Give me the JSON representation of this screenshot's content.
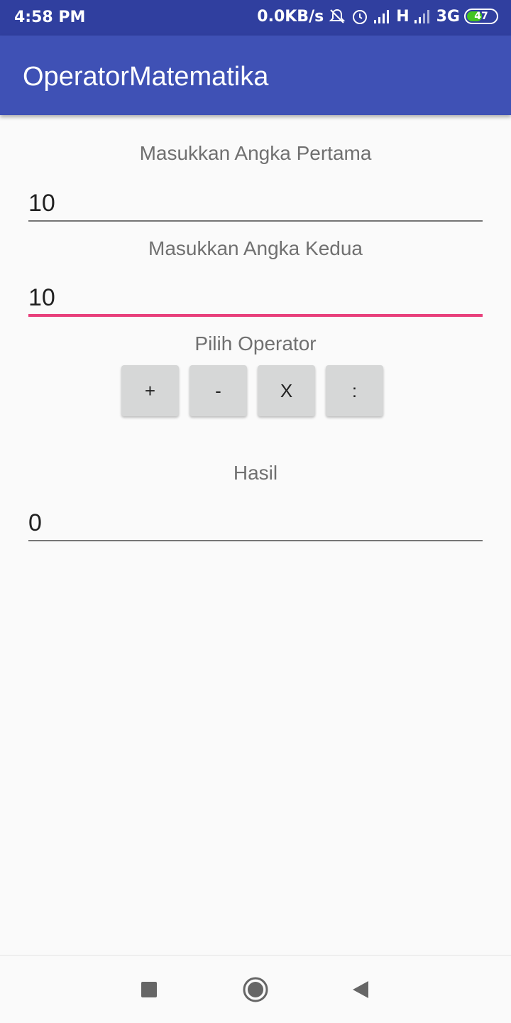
{
  "status_bar": {
    "time": "4:58 PM",
    "net_speed": "0.0KB/s",
    "net1": "H",
    "net2": "3G",
    "battery": "47",
    "battery_level": 0.47,
    "icons": [
      "mute-bell-icon",
      "alarm-icon",
      "signal-icon",
      "signal-icon",
      "battery-icon"
    ]
  },
  "app_bar": {
    "title": "OperatorMatematika"
  },
  "form": {
    "first_label": "Masukkan Angka Pertama",
    "first_value": "10",
    "second_label": "Masukkan Angka Kedua",
    "second_value": "10",
    "operator_label": "Pilih Operator",
    "operators": [
      "+",
      "-",
      "X",
      ":"
    ],
    "result_label": "Hasil",
    "result_value": "0"
  },
  "colors": {
    "primary": "#3f51b5",
    "primary_dark": "#303f9f",
    "accent": "#e8407b"
  },
  "nav_bar": {
    "icons": [
      "recents-icon",
      "home-icon",
      "back-icon"
    ]
  }
}
